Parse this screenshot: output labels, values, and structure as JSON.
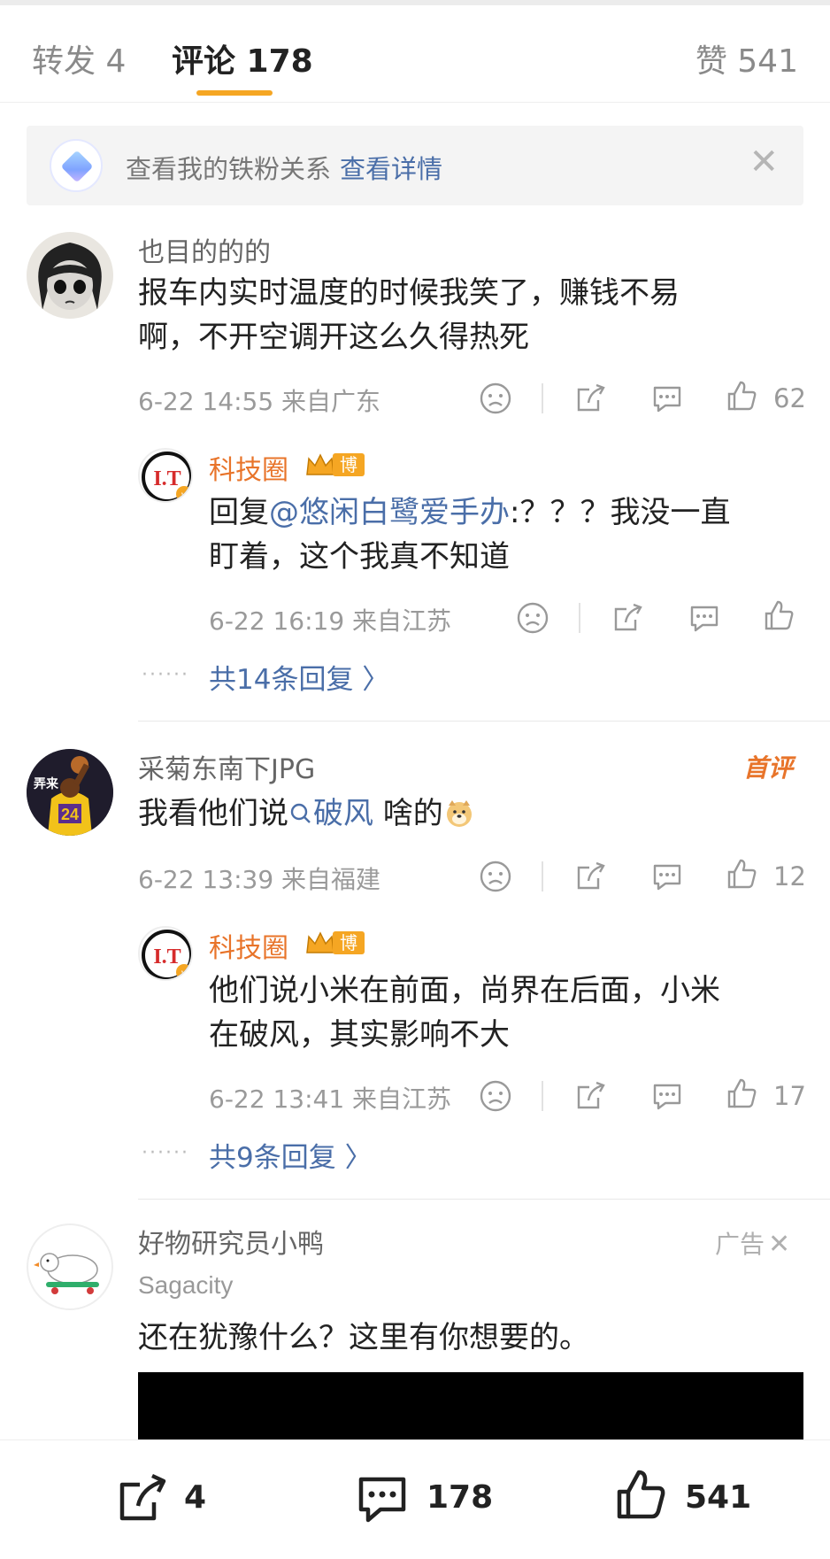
{
  "tabs": {
    "repost": "转发 4",
    "comments": "评论 178",
    "likes": "赞 541"
  },
  "banner": {
    "text": "查看我的铁粉关系",
    "link": "查看详情"
  },
  "comments": [
    {
      "user": "也目的的的",
      "text": "报车内实时温度的时候我笑了，赚钱不易啊，不开空调开这么久得热死",
      "line1": "报车内实时温度的时候我笑了，赚钱不易",
      "line2": "啊，不开空调开这么久得热死",
      "time": "6-22 14:55",
      "location": "来自广东",
      "likes": "62",
      "reply": {
        "user": "科技圈",
        "badge": "博主",
        "prefix": "回复",
        "mention": "@悠闲白鹭爱手办",
        "line1_rest": ":？？？我没一直",
        "line2": "盯着，这个我真不知道",
        "time": "6-22 16:19",
        "location": "来自江苏"
      },
      "more_replies": "共14条回复 〉"
    },
    {
      "user": "采菊东南下JPG",
      "first_tag": "首评",
      "text_before": "我看他们说",
      "topic": "破风",
      "text_after": " 啥的",
      "time": "6-22 13:39",
      "location": "来自福建",
      "likes": "12",
      "reply": {
        "user": "科技圈",
        "badge": "博主",
        "line1": "他们说小米在前面，尚界在后面，小米",
        "line2": "在破风，其实影响不大",
        "time": "6-22 13:41",
        "location": "来自江苏",
        "likes": "17"
      },
      "more_replies": "共9条回复 〉"
    }
  ],
  "ad": {
    "user": "好物研究员小鸭",
    "tag": "广告",
    "brand": "Sagacity",
    "text": "还在犹豫什么？这里有你想要的。"
  },
  "bottom_bar": {
    "repost_count": "4",
    "comment_count": "178",
    "like_count": "541"
  },
  "colors": {
    "accent": "#f5a623",
    "link": "#4a6ea8",
    "orange_name": "#e8742a"
  }
}
